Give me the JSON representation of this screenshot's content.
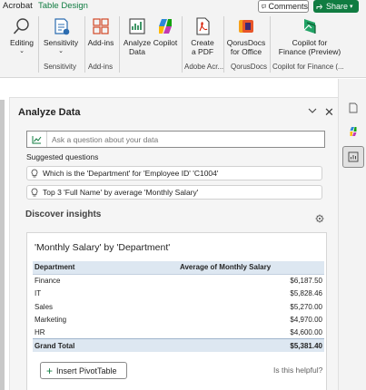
{
  "tabs": {
    "acrobat": "Acrobat",
    "table_design": "Table Design"
  },
  "top_buttons": {
    "comments": "Comments",
    "share": "Share"
  },
  "ribbon": {
    "editing": "Editing",
    "sensitivity": "Sensitivity",
    "sensitivity_group": "Sensitivity",
    "addins": "Add-ins",
    "addins_group": "Add-ins",
    "analyze_line1": "Analyze",
    "analyze_line2": "Data",
    "copilot": "Copilot",
    "create_line1": "Create",
    "create_line2": "a PDF",
    "adobe_group": "Adobe Acr...",
    "qorus_line1": "QorusDocs",
    "qorus_line2": "for Office",
    "qorus_group": "QorusDocs",
    "cff_line1": "Copilot for",
    "cff_line2": "Finance (Preview)",
    "cff_group": "Copilot for Finance (..."
  },
  "panel": {
    "title": "Analyze Data",
    "ask_placeholder": "Ask a question about your data",
    "suggested_label": "Suggested questions",
    "suggestions": [
      "Which is the 'Department' for 'Employee ID' 'C1004'",
      "Top 3 'Full Name' by average 'Monthly Salary'"
    ],
    "discover_label": "Discover insights"
  },
  "card": {
    "title": "'Monthly Salary' by 'Department'",
    "col_dept": "Department",
    "col_avg": "Average of Monthly Salary",
    "rows": [
      {
        "dept": "Finance",
        "value": "$6,187.50"
      },
      {
        "dept": "IT",
        "value": "$5,828.46"
      },
      {
        "dept": "Sales",
        "value": "$5,270.00"
      },
      {
        "dept": "Marketing",
        "value": "$4,970.00"
      },
      {
        "dept": "HR",
        "value": "$4,600.00"
      }
    ],
    "total_label": "Grand Total",
    "total_value": "$5,381.40",
    "insert_label": "Insert PivotTable",
    "helpful": "Is this helpful?"
  },
  "colors": {
    "excel_green": "#107c41",
    "header_blue": "#dde7f1",
    "panel_bg": "#f5f5f5"
  }
}
